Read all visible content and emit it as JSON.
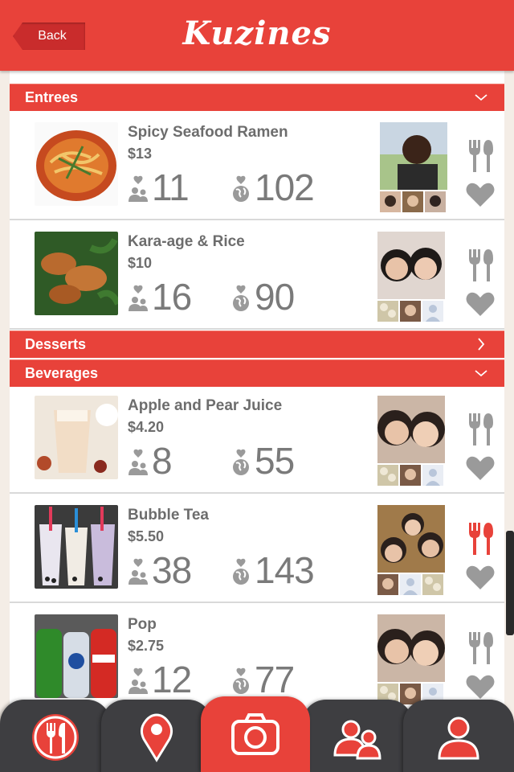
{
  "header": {
    "back_label": "Back",
    "logo": "Kuzines"
  },
  "sections": [
    {
      "title": "Entrees",
      "expanded": true,
      "icon": "chevron-down-icon"
    },
    {
      "title": "Desserts",
      "expanded": false,
      "icon": "chevron-right-icon"
    },
    {
      "title": "Beverages",
      "expanded": true,
      "icon": "chevron-down-icon"
    }
  ],
  "items": [
    {
      "name": "Spicy Seafood Ramen",
      "price": "$13",
      "friends": "11",
      "global": "102",
      "tasted": false
    },
    {
      "name": "Kara-age & Rice",
      "price": "$10",
      "friends": "16",
      "global": "90",
      "tasted": false
    },
    {
      "name": "Apple and Pear Juice",
      "price": "$4.20",
      "friends": "8",
      "global": "55",
      "tasted": false
    },
    {
      "name": "Bubble Tea",
      "price": "$5.50",
      "friends": "38",
      "global": "143",
      "tasted": true
    },
    {
      "name": "Pop",
      "price": "$2.75",
      "friends": "12",
      "global": "77",
      "tasted": false
    }
  ],
  "tabs": [
    {
      "name": "menu-tab",
      "icon": "fork-knife-icon",
      "active": false
    },
    {
      "name": "location-tab",
      "icon": "map-pin-icon",
      "active": false
    },
    {
      "name": "camera-tab",
      "icon": "camera-icon",
      "active": true
    },
    {
      "name": "friends-tab",
      "icon": "people-icon",
      "active": false
    },
    {
      "name": "profile-tab",
      "icon": "person-icon",
      "active": false
    }
  ],
  "colors": {
    "accent": "#e8423a",
    "dark_tab": "#3e3e41",
    "text_gray": "#6d6d6d",
    "icon_gray": "#9a9a9a"
  }
}
